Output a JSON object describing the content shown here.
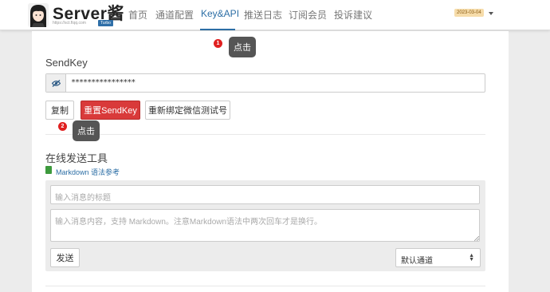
{
  "header": {
    "title": "Server酱",
    "url": "https://sct.ftqq.com",
    "badge": "Turbo",
    "nav": [
      {
        "label": "首页"
      },
      {
        "label": "通道配置"
      },
      {
        "label": "Key&API",
        "active": true
      },
      {
        "label": "推送日志"
      },
      {
        "label": "订阅会员"
      },
      {
        "label": "投诉建议"
      }
    ],
    "date": "2023-03-04",
    "accent_color": "#2c6ea5"
  },
  "sendkey": {
    "label": "SendKey",
    "value": "****************",
    "toggle_icon": "eye-slash-icon",
    "copy_label": "复制",
    "reset_label": "重置SendKey",
    "rebind_label": "重新绑定微信测试号",
    "reset_color": "#d93a3a"
  },
  "tool": {
    "title": "在线发送工具",
    "md_icon": "book-icon",
    "md_link": "Markdown 语法参考",
    "title_placeholder": "输入消息的标题",
    "content_placeholder": "输入消息内容，支持 Markdown。注意Markdown语法中两次回车才是换行。",
    "send_label": "发送",
    "channel_value": "默认通道"
  },
  "annotations": [
    {
      "num": "1",
      "text": "点击"
    },
    {
      "num": "2",
      "text": "点击"
    }
  ]
}
